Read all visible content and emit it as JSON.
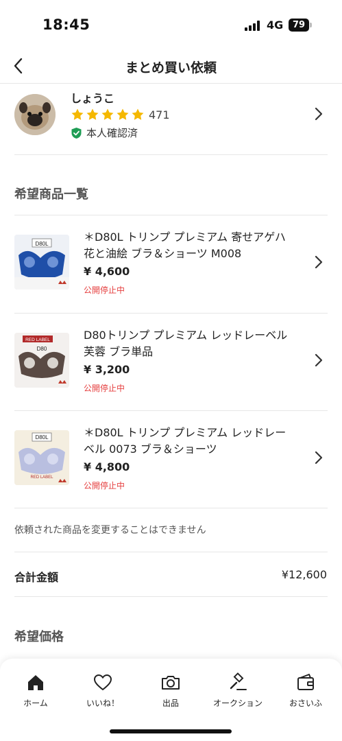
{
  "status_bar": {
    "time": "18:45",
    "network": "4G",
    "battery": "79"
  },
  "header": {
    "title": "まとめ買い依頼"
  },
  "seller": {
    "name": "しょうこ",
    "rating_count": "471",
    "verified_label": "本人確認済",
    "star_color": "#f5b800",
    "verified_color": "#1f9d55"
  },
  "products_section": {
    "title": "希望商品一覧"
  },
  "items": [
    {
      "title": "＊D80L トリンプ プレミアム 寄せアゲハ 花と油絵 ブラ＆ショーツ M008",
      "price": "¥ 4,600",
      "status": "公開停止中"
    },
    {
      "title": "D80トリンプ プレミアム レッドレーベル 芙蓉 ブラ単品",
      "price": "¥ 3,200",
      "status": "公開停止中"
    },
    {
      "title": "＊D80L トリンプ プレミアム レッドレーベル 0073 ブラ＆ショーツ",
      "price": "¥ 4,800",
      "status": "公開停止中"
    }
  ],
  "notice": "依頼された商品を変更することはできません",
  "total": {
    "label": "合計金額",
    "value": "¥12,600"
  },
  "price_section": {
    "title": "希望価格"
  },
  "tabs": [
    {
      "label": "ホーム",
      "icon": "home-icon"
    },
    {
      "label": "いいね！",
      "icon": "heart-icon"
    },
    {
      "label": "出品",
      "icon": "camera-icon"
    },
    {
      "label": "オークション",
      "icon": "gavel-icon"
    },
    {
      "label": "おさいふ",
      "icon": "wallet-icon"
    }
  ],
  "colors": {
    "accent_red": "#e53e3e"
  }
}
